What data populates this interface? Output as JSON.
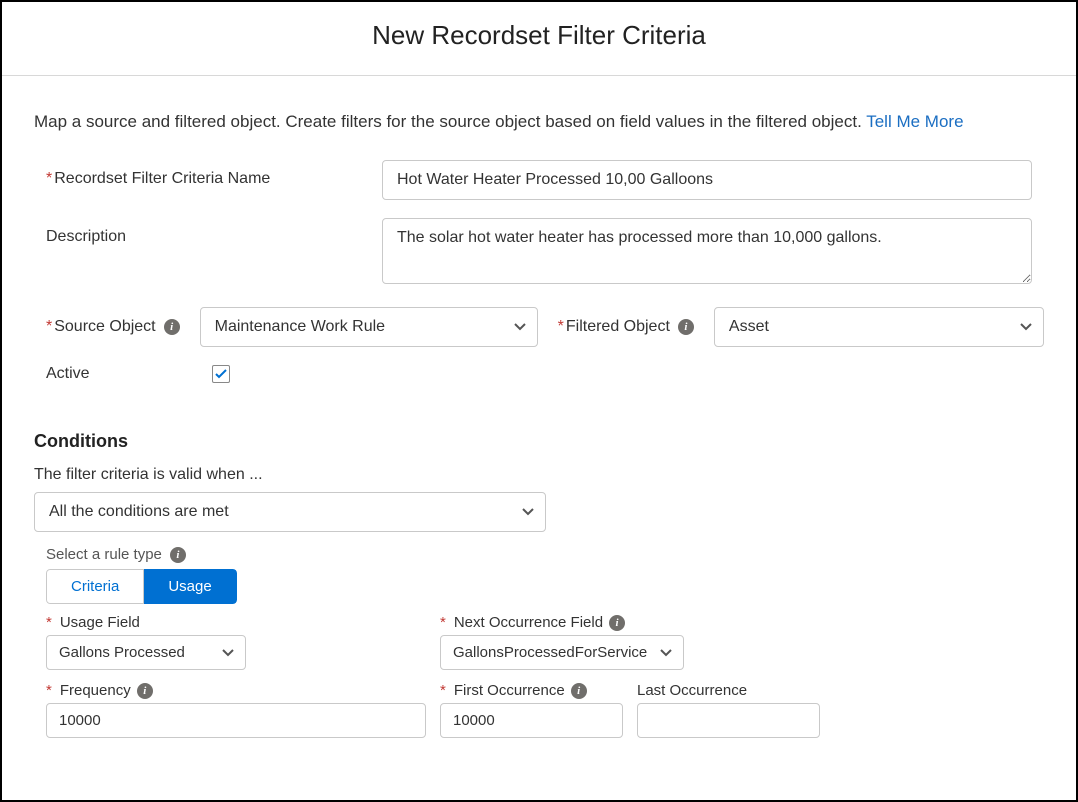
{
  "header": {
    "title": "New Recordset Filter Criteria"
  },
  "intro": {
    "text": "Map a source and filtered object. Create filters for the source object based on field values in the filtered object. ",
    "link": "Tell Me More"
  },
  "labels": {
    "name": "Recordset Filter Criteria Name",
    "description": "Description",
    "sourceObject": "Source Object",
    "filteredObject": "Filtered Object",
    "active": "Active"
  },
  "values": {
    "name": "Hot Water Heater Processed 10,00 Galloons",
    "description": "The solar hot water heater has processed more than 10,000 gallons.",
    "sourceObject": "Maintenance Work Rule",
    "filteredObject": "Asset",
    "active": true
  },
  "conditions": {
    "title": "Conditions",
    "helper": "The filter criteria is valid when ...",
    "logic": "All the conditions are met",
    "ruleTypeLabel": "Select a rule type",
    "tabs": {
      "criteria": "Criteria",
      "usage": "Usage"
    }
  },
  "usage": {
    "labels": {
      "usageField": "Usage Field",
      "nextOccurrence": "Next Occurrence Field",
      "frequency": "Frequency",
      "firstOccurrence": "First Occurrence",
      "lastOccurrence": "Last Occurrence"
    },
    "values": {
      "usageField": "Gallons Processed",
      "nextOccurrence": "GallonsProcessedForService",
      "frequency": "10000",
      "firstOccurrence": "10000",
      "lastOccurrence": ""
    }
  }
}
